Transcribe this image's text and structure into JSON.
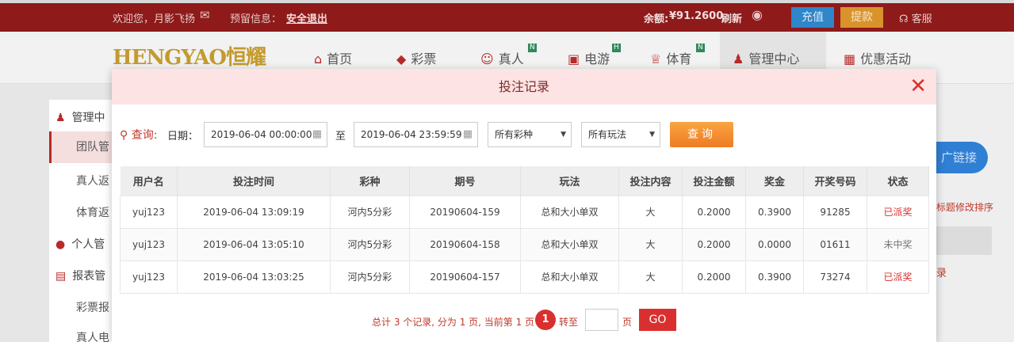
{
  "topbar": {
    "welcome": "欢迎您，月影飞扬",
    "reserved_label": "预留信息：",
    "logout": "安全退出",
    "balance_label": "余额:",
    "balance": "¥91.2600",
    "refresh": "刷新",
    "recharge": "充值",
    "withdraw": "提款",
    "support": "客服"
  },
  "nav": {
    "logo": "HENGYAO恒耀",
    "items": [
      {
        "label": "首页",
        "icon": "home-icon",
        "badge": ""
      },
      {
        "label": "彩票",
        "icon": "lottery-icon",
        "badge": ""
      },
      {
        "label": "真人",
        "icon": "live-casino-icon",
        "badge": "N"
      },
      {
        "label": "电游",
        "icon": "slot-machine-icon",
        "badge": "H"
      },
      {
        "label": "体育",
        "icon": "trophy-icon",
        "badge": "N"
      },
      {
        "label": "管理中心",
        "icon": "users-icon",
        "badge": ""
      },
      {
        "label": "优惠活动",
        "icon": "gift-icon",
        "badge": ""
      }
    ]
  },
  "sidebar": {
    "items": [
      "管理中",
      "团队管",
      "真人返",
      "体育返",
      "个人管",
      "报表管",
      "彩票报",
      "真人电"
    ]
  },
  "background": {
    "promo_link": "广链接",
    "sort_hint": "标题修改排序",
    "right_fragment": "录"
  },
  "modal": {
    "title": "投注记录",
    "close": "✕",
    "query_label": "查询:",
    "date_label": "日期：",
    "start_date": "2019-06-04 00:00:00",
    "to_label": "至",
    "end_date": "2019-06-04 23:59:59",
    "lottery_select": "所有彩种",
    "play_select": "所有玩法",
    "query_button": "查询"
  },
  "table": {
    "headers": [
      "用户名",
      "投注时间",
      "彩种",
      "期号",
      "玩法",
      "投注内容",
      "投注金额",
      "奖金",
      "开奖号码",
      "状态"
    ],
    "rows": [
      [
        "yuj123",
        "2019-06-04 13:09:19",
        "河内5分彩",
        "20190604-159",
        "总和大小单双",
        "大",
        "0.2000",
        "0.3900",
        "91285",
        "已派奖"
      ],
      [
        "yuj123",
        "2019-06-04 13:05:10",
        "河内5分彩",
        "20190604-158",
        "总和大小单双",
        "大",
        "0.2000",
        "0.0000",
        "01611",
        "未中奖"
      ],
      [
        "yuj123",
        "2019-06-04 13:03:25",
        "河内5分彩",
        "20190604-157",
        "总和大小单双",
        "大",
        "0.2000",
        "0.3900",
        "73274",
        "已派奖"
      ]
    ]
  },
  "pager": {
    "summary": "总计 3 个记录, 分为 1 页, 当前第 1 页",
    "current_page": "1",
    "goto_label": "转至",
    "page_unit": "页",
    "go": "GO"
  },
  "colors": {
    "brand_red": "#8e1a1a",
    "accent_red": "#d9302f",
    "query_orange": "#ee7b21"
  }
}
